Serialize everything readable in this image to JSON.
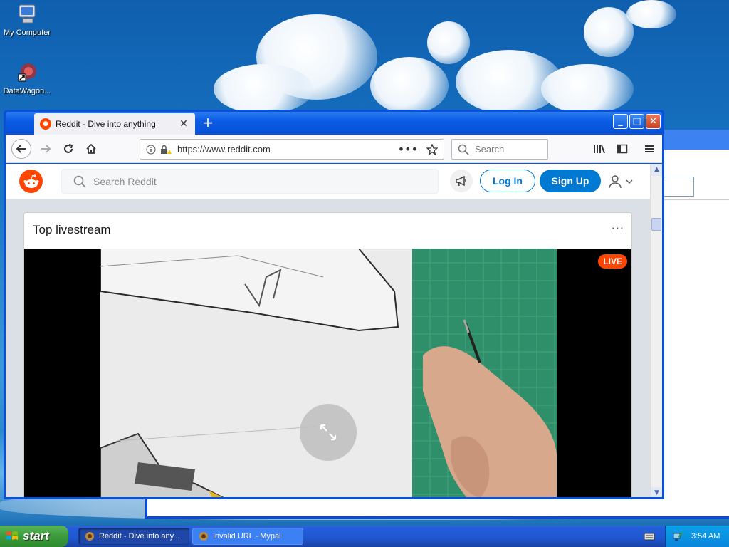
{
  "desktop": {
    "icons": [
      {
        "label": "My Computer"
      },
      {
        "label": "DataWagon..."
      }
    ]
  },
  "browser": {
    "tab_title": "Reddit - Dive into anything",
    "new_tab_label": "+",
    "url": "https://www.reddit.com",
    "search_placeholder": "Search"
  },
  "reddit": {
    "search_placeholder": "Search Reddit",
    "login_label": "Log In",
    "signup_label": "Sign Up",
    "section_title": "Top livestream",
    "more_label": "···",
    "live_badge": "LIVE"
  },
  "taskbar": {
    "start_label": "start",
    "tasks": [
      {
        "label": "Reddit - Dive into any...",
        "active": true
      },
      {
        "label": "Invalid URL - Mypal",
        "active": false
      }
    ],
    "clock": "3:54 AM"
  },
  "colors": {
    "reddit_orange": "#ff4500",
    "reddit_blue": "#0079d3",
    "xp_blue": "#0a54e0"
  }
}
